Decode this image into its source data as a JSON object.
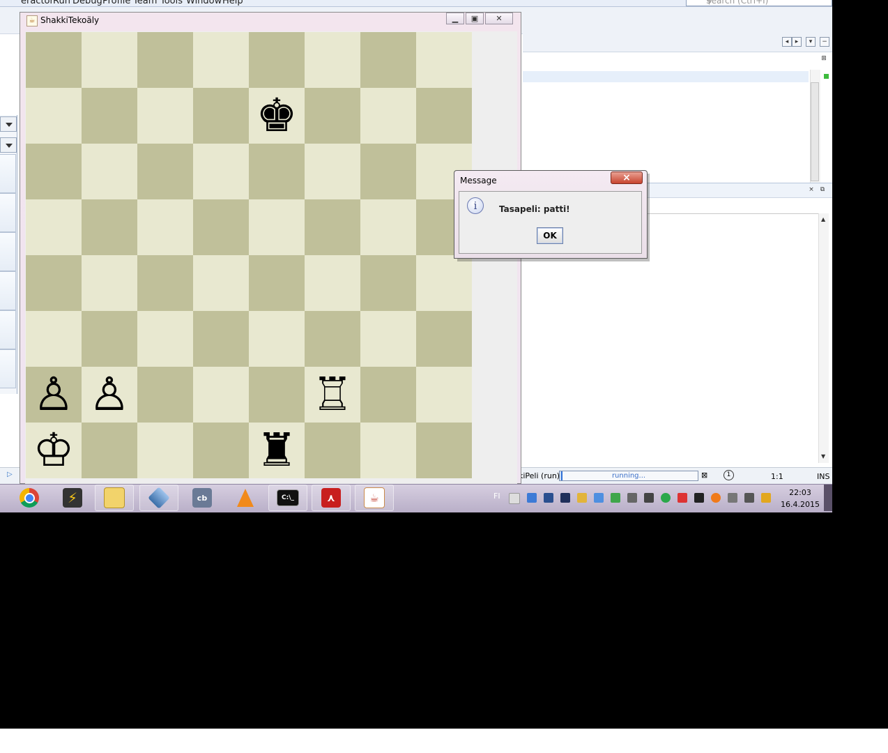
{
  "ide": {
    "menu": [
      "eractor",
      "Run",
      "Debug",
      "Profile",
      "Team",
      "Tools",
      "Window",
      "Help"
    ],
    "search_placeholder": "Search (Ctrl+I)",
    "status": {
      "task": "kiPeli (run)",
      "progress_text": "running...",
      "progress_fraction": 0.01,
      "notifications": "1",
      "position": "1:1",
      "mode": "INS"
    }
  },
  "chess_window": {
    "title": "ShakkiTekoäly",
    "board": {
      "colors": {
        "light": "#e8e8d0",
        "dark": "#c0c09a"
      },
      "pieces": [
        {
          "square": "e7",
          "piece": "black-king",
          "glyph": "♚"
        },
        {
          "square": "a2",
          "piece": "white-pawn",
          "glyph": "♙"
        },
        {
          "square": "b2",
          "piece": "white-pawn",
          "glyph": "♙"
        },
        {
          "square": "f2",
          "piece": "white-rook",
          "glyph": "♖"
        },
        {
          "square": "a1",
          "piece": "white-king",
          "glyph": "♔"
        },
        {
          "square": "e1",
          "piece": "black-rook",
          "glyph": "♜"
        }
      ]
    }
  },
  "dialog": {
    "title": "Message",
    "message": "Tasapeli: patti!",
    "icon": "info-icon",
    "ok_label": "OK"
  },
  "taskbar": {
    "apps": [
      {
        "name": "chrome-icon",
        "pinned": false
      },
      {
        "name": "winamp-icon",
        "pinned": false
      },
      {
        "name": "explorer-icon",
        "pinned": true
      },
      {
        "name": "virtualbox-icon",
        "pinned": true
      },
      {
        "name": "codeblocks-icon",
        "pinned": false
      },
      {
        "name": "vlc-icon",
        "pinned": false
      },
      {
        "name": "cmd-icon",
        "pinned": true
      },
      {
        "name": "acrobat-icon",
        "pinned": true
      },
      {
        "name": "java-icon",
        "pinned": true
      }
    ],
    "language": "FI",
    "time": "22:03",
    "date": "16.4.2015"
  }
}
